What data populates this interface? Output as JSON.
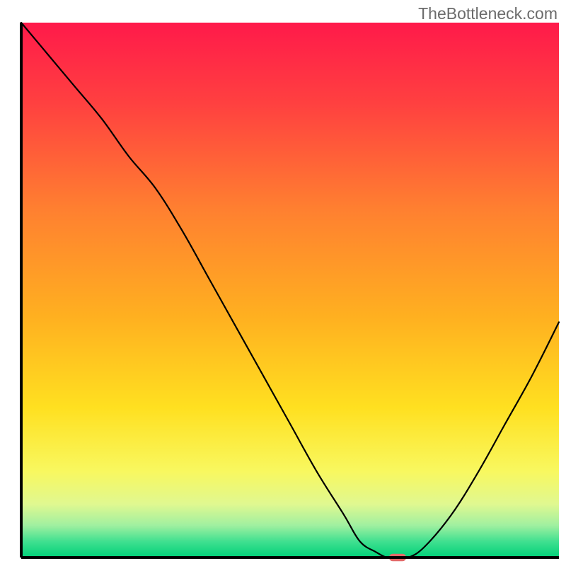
{
  "watermark": "TheBottleneck.com",
  "chart_data": {
    "type": "line",
    "title": "",
    "xlabel": "",
    "ylabel": "",
    "xlim": [
      0,
      100
    ],
    "ylim": [
      0,
      100
    ],
    "background_gradient": {
      "type": "vertical",
      "stops": [
        {
          "pos": 0.0,
          "color": "#ff1a4a"
        },
        {
          "pos": 0.15,
          "color": "#ff4040"
        },
        {
          "pos": 0.35,
          "color": "#ff8030"
        },
        {
          "pos": 0.55,
          "color": "#ffb020"
        },
        {
          "pos": 0.72,
          "color": "#ffe020"
        },
        {
          "pos": 0.84,
          "color": "#f8f860"
        },
        {
          "pos": 0.9,
          "color": "#e0f890"
        },
        {
          "pos": 0.94,
          "color": "#a0f0a0"
        },
        {
          "pos": 0.97,
          "color": "#40e090"
        },
        {
          "pos": 1.0,
          "color": "#00d078"
        }
      ]
    },
    "series": [
      {
        "name": "bottleneck-curve",
        "color": "#000000",
        "stroke_width": 2.2,
        "x": [
          0,
          5,
          10,
          15,
          20,
          25,
          30,
          35,
          40,
          45,
          50,
          55,
          60,
          63,
          66,
          68,
          70,
          72,
          75,
          80,
          85,
          90,
          95,
          100
        ],
        "values": [
          100,
          94,
          88,
          82,
          75,
          69,
          61,
          52,
          43,
          34,
          25,
          16,
          8,
          3,
          1,
          0,
          0,
          0,
          2,
          8,
          16,
          25,
          34,
          44
        ]
      }
    ],
    "marker": {
      "name": "optimal-point",
      "x": 70,
      "y": 0,
      "width_pct": 3.2,
      "height_pct": 1.4,
      "color": "#e36a6a"
    },
    "frame": {
      "color": "#000000",
      "left": true,
      "right": false,
      "top": false,
      "bottom": true,
      "stroke_width": 4
    }
  }
}
